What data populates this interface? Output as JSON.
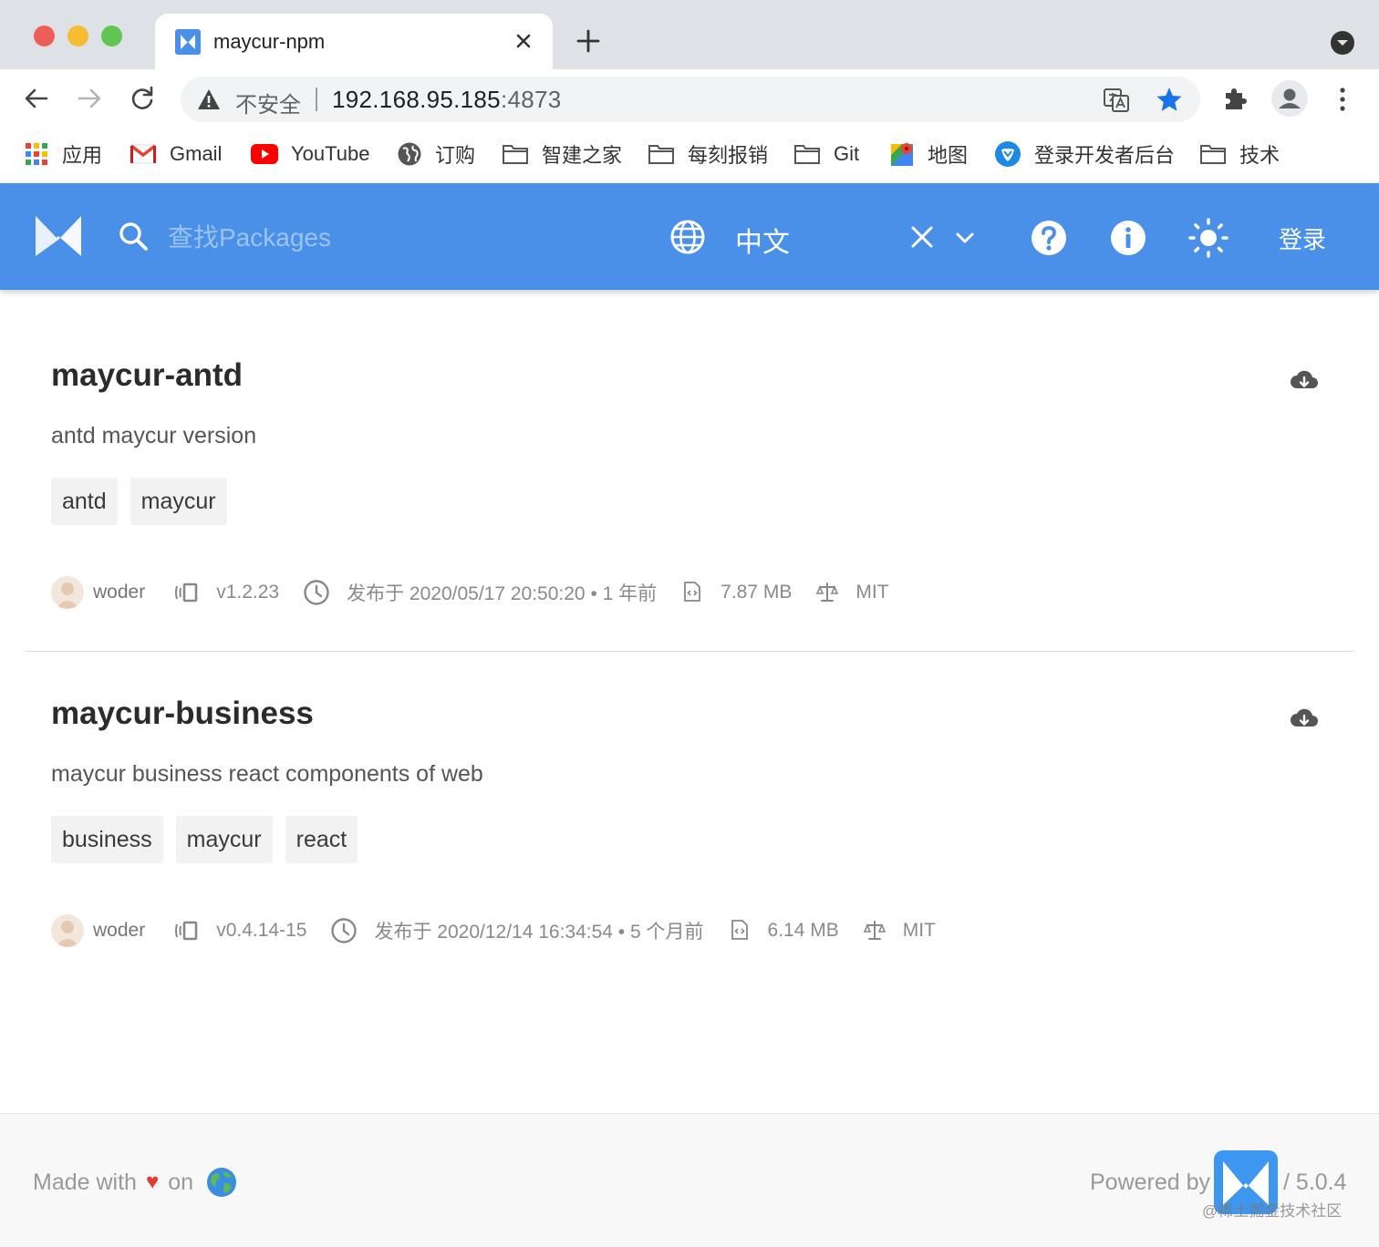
{
  "browser": {
    "tab": {
      "title": "maycur-npm"
    },
    "omnibox": {
      "security_label": "不安全",
      "url_host": "192.168.95.185",
      "url_port": ":4873"
    },
    "bookmarks": [
      {
        "label": "应用",
        "icon": "apps-grid-icon"
      },
      {
        "label": "Gmail",
        "icon": "gmail-icon"
      },
      {
        "label": "YouTube",
        "icon": "youtube-icon"
      },
      {
        "label": "订购",
        "icon": "globe-icon"
      },
      {
        "label": "智建之家",
        "icon": "folder-icon"
      },
      {
        "label": "每刻报销",
        "icon": "folder-icon"
      },
      {
        "label": "Git",
        "icon": "folder-icon"
      },
      {
        "label": "地图",
        "icon": "maps-icon"
      },
      {
        "label": "登录开发者后台",
        "icon": "shield-bird-icon"
      },
      {
        "label": "技术",
        "icon": "folder-icon"
      }
    ]
  },
  "header": {
    "search_placeholder": "查找Packages",
    "language": "中文",
    "login_label": "登录",
    "accent_color": "#4a90e8"
  },
  "packages": [
    {
      "name": "maycur-antd",
      "description": "antd maycur version",
      "keywords": [
        "antd",
        "maycur"
      ],
      "author": "woder",
      "version": "v1.2.23",
      "published": "发布于 2020/05/17 20:50:20 • 1 年前",
      "size": "7.87 MB",
      "license": "MIT"
    },
    {
      "name": "maycur-business",
      "description": "maycur business react components of web",
      "keywords": [
        "business",
        "maycur",
        "react"
      ],
      "author": "woder",
      "version": "v0.4.14-15",
      "published": "发布于 2020/12/14 16:34:54 • 5 个月前",
      "size": "6.14 MB",
      "license": "MIT"
    }
  ],
  "footer": {
    "made_with": "Made with",
    "on": "on",
    "powered_by": "Powered by",
    "version": "/ 5.0.4",
    "watermark": "@稀土掘金技术社区"
  }
}
